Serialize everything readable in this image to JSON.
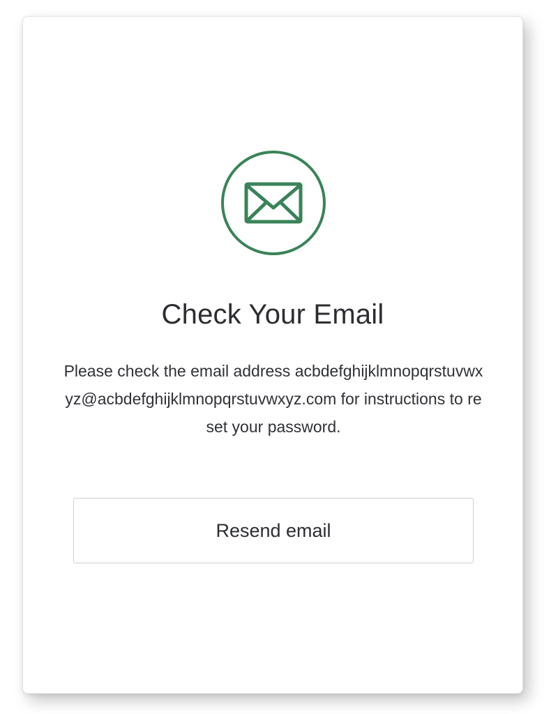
{
  "card": {
    "icon": "envelope-icon",
    "title": "Check Your Email",
    "message": {
      "before": "Please check the email address ",
      "email": "acbdefghijklmnopqrstuvwxyz@acbdefghijklmnopqrstuvwxyz.com",
      "after": " for instructions to reset your password."
    },
    "resend_label": "Resend email"
  },
  "colors": {
    "accent": "#3a8358",
    "text": "#2b2d31",
    "button_border": "#cfcfcf"
  }
}
